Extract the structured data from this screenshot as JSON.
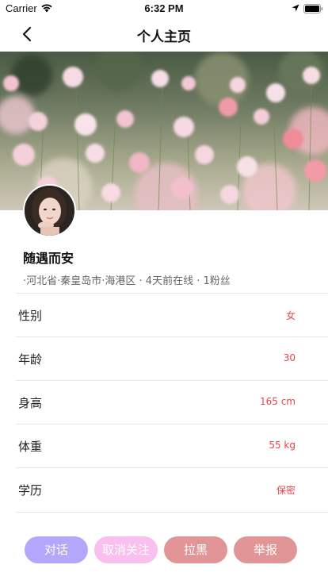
{
  "status_bar": {
    "carrier": "Carrier",
    "time": "6:32 PM",
    "icons": [
      "wifi-icon",
      "location-arrow-icon",
      "battery-icon"
    ]
  },
  "nav": {
    "title": "个人主页",
    "back_icon": "chevron-left-icon"
  },
  "profile": {
    "username": "随遇而安",
    "meta": "·河北省·秦皇岛市·海港区 · 4天前在线 · 1粉丝"
  },
  "details": [
    {
      "label": "性别",
      "value": "女"
    },
    {
      "label": "年龄",
      "value": "30"
    },
    {
      "label": "身高",
      "value": "165 cm"
    },
    {
      "label": "体重",
      "value": "55 kg"
    },
    {
      "label": "学历",
      "value": "保密"
    }
  ],
  "actions": {
    "chat": "对话",
    "unfollow": "取消关注",
    "block": "拉黑",
    "report": "举报"
  },
  "colors": {
    "value_text": "#e8434b",
    "chat_button": "#b3a6fb",
    "unfollow_button": "#f9c0ef",
    "block_button": "#e19596",
    "report_button": "#e19596"
  }
}
